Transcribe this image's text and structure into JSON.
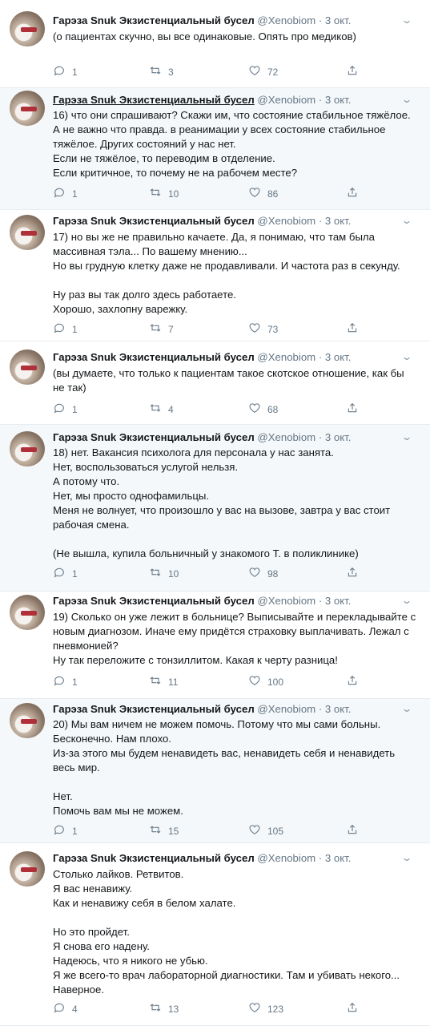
{
  "author": {
    "name": "Гарэза Snuk Экзистенциальный бусел",
    "handle": "@Xenobiom",
    "dot": "·",
    "time": "3 окт."
  },
  "icons": {
    "reply": "reply-icon",
    "retweet": "retweet-icon",
    "like": "heart-icon",
    "share": "share-icon",
    "menu": "chevron-down-icon"
  },
  "tweets": [
    {
      "lines": [
        "(о пациентах скучно, вы все одинаковые. Опять про медиков)"
      ],
      "replies": "1",
      "retweets": "3",
      "likes": "72"
    },
    {
      "lines": [
        "16) что они спрашивают? Скажи им, что состояние стабильное тяжёлое.",
        "А не важно что правда. в реанимации у всех состояние стабильное",
        "тяжёлое. Других состояний у нас нет.",
        "Если не тяжёлое, то переводим в отделение.",
        "Если критичное, то почему не на рабочем месте?"
      ],
      "replies": "1",
      "retweets": "10",
      "likes": "86"
    },
    {
      "lines": [
        "17) но вы же не правильно качаете. Да, я понимаю, что там была",
        "массивная тэла... По вашему мнению...",
        "Но вы грудную клетку даже не продавливали. И частота раз в секунду.",
        "",
        "Ну раз вы так долго здесь работаете.",
        "Хорошо, захлопну варежку."
      ],
      "replies": "1",
      "retweets": "7",
      "likes": "73"
    },
    {
      "lines": [
        "(вы думаете, что только к пациентам такое скотское отношение, как бы",
        "не так)"
      ],
      "replies": "1",
      "retweets": "4",
      "likes": "68"
    },
    {
      "lines": [
        "18) нет. Вакансия психолога для персонала у нас занята.",
        "Нет, воспользоваться услугой нельзя.",
        "А потому что.",
        "Нет, мы просто однофамильцы.",
        "Меня не волнует, что произошло у вас на вызове, завтра у вас стоит",
        "рабочая смена.",
        "",
        "(Не вышла, купила больничный у знакомого Т. в поликлинике)"
      ],
      "replies": "1",
      "retweets": "10",
      "likes": "98"
    },
    {
      "lines": [
        "19) Сколько он уже лежит в больнице? Выписывайте и перекладывайте с",
        "новым диагнозом. Иначе ему придётся страховку выплачивать. Лежал с",
        "пневмонией?",
        "Ну так переложите с тонзиллитом. Какая к черту разница!"
      ],
      "replies": "1",
      "retweets": "11",
      "likes": "100"
    },
    {
      "lines": [
        "20) Мы вам ничем не можем помочь. Потому что мы сами больны.",
        "Бесконечно. Нам плохо.",
        "Из-за этого мы будем ненавидеть вас, ненавидеть себя и ненавидеть",
        "весь мир.",
        "",
        "Нет.",
        "Помочь вам мы не можем."
      ],
      "replies": "1",
      "retweets": "15",
      "likes": "105"
    },
    {
      "lines": [
        "Столько лайков. Ретвитов.",
        "Я вас ненавижу.",
        "Как и ненавижу себя в белом халате.",
        "",
        "Но это пройдет.",
        "Я снова его надену.",
        "Надеюсь, что я никого не убью.",
        "Я же всего-то врач лабораторной диагностики. Там и убивать некого...",
        "Наверное."
      ],
      "replies": "4",
      "retweets": "13",
      "likes": "123"
    }
  ]
}
